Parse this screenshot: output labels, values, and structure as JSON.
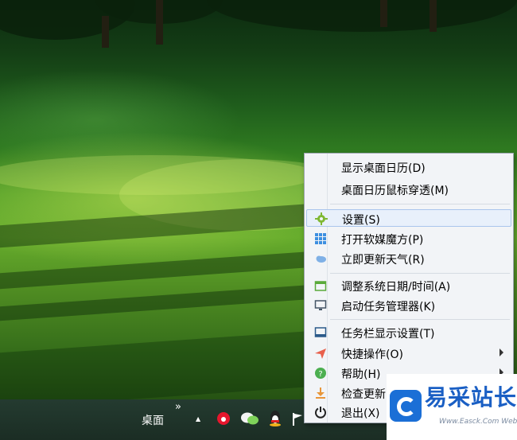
{
  "taskbar": {
    "toolbar_label": "桌面",
    "expand_glyph": "»",
    "tray_up_glyph": "▲"
  },
  "menu": {
    "items": [
      {
        "label": "显示桌面日历(D)",
        "icon": null
      },
      {
        "label": "桌面日历鼠标穿透(M)",
        "icon": null
      },
      {
        "label": "设置(S)",
        "icon": "gear-icon",
        "highlighted": true
      },
      {
        "label": "打开软媒魔方(P)",
        "icon": "grid-icon"
      },
      {
        "label": "立即更新天气(R)",
        "icon": "cloud-icon"
      },
      {
        "label": "调整系统日期/时间(A)",
        "icon": "calendar-icon"
      },
      {
        "label": "启动任务管理器(K)",
        "icon": "monitor-icon"
      },
      {
        "label": "任务栏显示设置(T)",
        "icon": "taskbar-icon"
      },
      {
        "label": "快捷操作(O)",
        "icon": "send-icon",
        "submenu": true
      },
      {
        "label": "帮助(H)",
        "icon": "help-icon",
        "submenu": true
      },
      {
        "label": "检查更新",
        "icon": "download-icon"
      },
      {
        "label": "退出(X)",
        "icon": "power-icon"
      }
    ]
  },
  "watermark": {
    "title": "易采站长站",
    "subtitle": "Www.Easck.Com Website"
  },
  "colors": {
    "highlight": "#e8f0fb",
    "accent": "#1b6fd6"
  }
}
